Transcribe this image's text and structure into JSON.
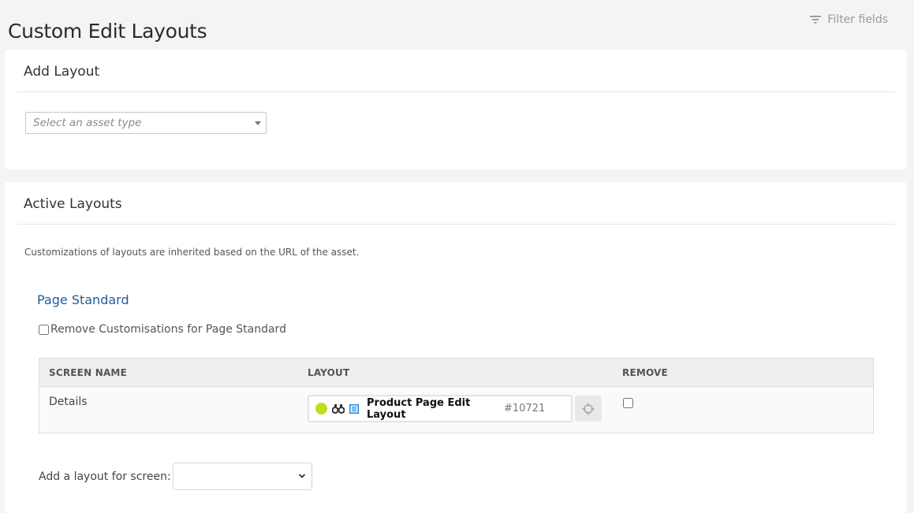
{
  "header": {
    "title": "Custom Edit Layouts",
    "filter_label": "Filter fields"
  },
  "add_layout": {
    "title": "Add Layout",
    "asset_type_select": {
      "placeholder": "Select an asset type",
      "value": ""
    }
  },
  "active_layouts": {
    "title": "Active Layouts",
    "help_text": "Customizations of layouts are inherited based on the URL of the asset.",
    "groups": [
      {
        "name": "Page Standard",
        "remove_label": "Remove Customisations for Page Standard",
        "remove_checked": false,
        "table": {
          "columns": [
            "SCREEN NAME",
            "LAYOUT",
            "REMOVE"
          ],
          "rows": [
            {
              "screen_name": "Details",
              "layout": {
                "status_color": "#bfdf1a",
                "name": "Product Page Edit Layout",
                "id": "#10721"
              },
              "remove_checked": false
            }
          ]
        },
        "add_screen": {
          "label": "Add a layout for screen:",
          "value": ""
        }
      }
    ]
  },
  "colors": {
    "accent_link": "#1f5d96",
    "status_live": "#bfdf1a",
    "asset_icon": "#1e88e5"
  }
}
